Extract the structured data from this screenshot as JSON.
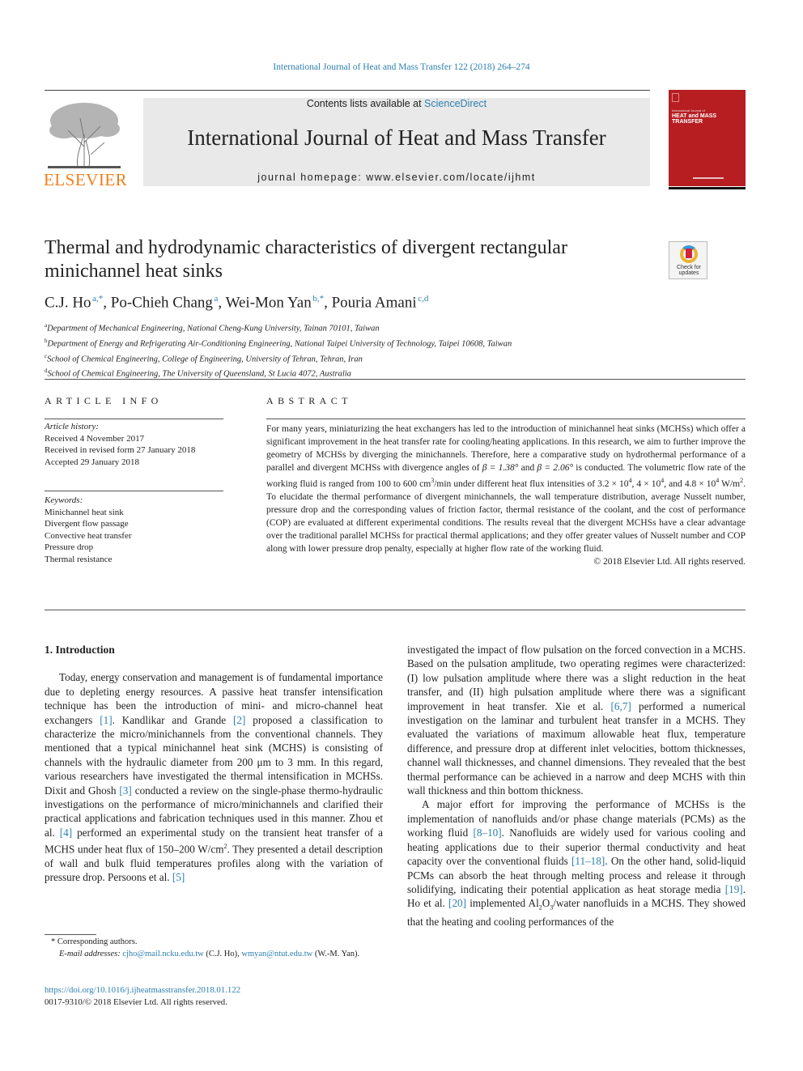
{
  "running_head": "International Journal of Heat and Mass Transfer 122 (2018) 264–274",
  "masthead": {
    "publisher_logo_text": "ELSEVIER",
    "contents_prefix": "Contents lists available at ",
    "contents_link": "ScienceDirect",
    "journal_name": "International Journal of Heat and Mass Transfer",
    "homepage": "journal homepage: www.elsevier.com/locate/ijhmt",
    "cover": {
      "line1": "International Journal of",
      "line2": "HEAT and MASS",
      "line3": "TRANSFER",
      "color": "#b61e22"
    }
  },
  "article": {
    "title": "Thermal and hydrodynamic characteristics of divergent rectangular minichannel heat sinks",
    "check_updates": [
      "Check for",
      "updates"
    ],
    "authors": [
      {
        "name": "C.J. Ho",
        "sup": "a,*"
      },
      {
        "name": "Po-Chieh Chang",
        "sup": "a"
      },
      {
        "name": "Wei-Mon Yan",
        "sup": "b,*"
      },
      {
        "name": "Pouria Amani",
        "sup": "c,d"
      }
    ],
    "affiliations": [
      {
        "key": "a",
        "text": "Department of Mechanical Engineering, National Cheng-Kung University, Tainan 70101, Taiwan"
      },
      {
        "key": "b",
        "text": "Department of Energy and Refrigerating Air-Conditioning Engineering, National Taipei University of Technology, Taipei 10608, Taiwan"
      },
      {
        "key": "c",
        "text": "School of Chemical Engineering, College of Engineering, University of Tehran, Tehran, Iran"
      },
      {
        "key": "d",
        "text": "School of Chemical Engineering, The University of Queensland, St Lucia 4072, Australia"
      }
    ]
  },
  "article_info": {
    "heading": "ARTICLE INFO",
    "history_label": "Article history:",
    "history": [
      "Received 4 November 2017",
      "Received in revised form 27 January 2018",
      "Accepted 29 January 2018"
    ],
    "keywords_label": "Keywords:",
    "keywords": [
      "Minichannel heat sink",
      "Divergent flow passage",
      "Convective heat transfer",
      "Pressure drop",
      "Thermal resistance"
    ]
  },
  "abstract": {
    "heading": "ABSTRACT",
    "p1": "For many years, miniaturizing the heat exchangers has led to the introduction of minichannel heat sinks (MCHSs) which offer a significant improvement in the heat transfer rate for cooling/heating applications. In this research, we aim to further improve the geometry of MCHSs by diverging the minichannels. Therefore, here a comparative study on hydrothermal performance of a parallel and divergent MCHSs with divergence angles of ",
    "beta1": "β = 1.38°",
    "and1": " and ",
    "beta2": "β = 2.06°",
    "p2": " is conducted. The volumetric flow rate of the working fluid is ranged from 100 to 600 cm",
    "sup3": "3",
    "p3": "/min under different heat flux intensities of 3.2 × 10",
    "sup4a": "4",
    "p4": ", 4 × 10",
    "sup4b": "4",
    "p5": ", and 4.8 × 10",
    "sup4c": "4",
    "p6": " W/m",
    "sup2": "2",
    "p7": ". To elucidate the thermal performance of divergent minichannels, the wall temperature distribution, average Nusselt number, pressure drop and the corresponding values of friction factor, thermal resistance of the coolant, and the cost of performance (COP) are evaluated at different experimental conditions. The results reveal that the divergent MCHSs have a clear advantage over the traditional parallel MCHSs for practical thermal applications; and they offer greater values of Nusselt number and COP along with lower pressure drop penalty, especially at higher flow rate of the working fluid.",
    "copyright": "© 2018 Elsevier Ltd. All rights reserved."
  },
  "body": {
    "section_heading": "1. Introduction",
    "left": {
      "t1": "Today, energy conservation and management is of fundamental importance due to depleting energy resources. A passive heat transfer intensification technique has been the introduction of mini- and micro-channel heat exchangers ",
      "c1": "[1]",
      "t2": ". Kandlikar and Grande ",
      "c2": "[2]",
      "t3": " proposed a classification to characterize the micro/minichannels from the conventional channels. They mentioned that a typical minichannel heat sink (MCHS) is consisting of channels with the hydraulic diameter from 200 μm to 3 mm. In this regard, various researchers have investigated the thermal intensification in MCHSs. Dixit and Ghosh ",
      "c3": "[3]",
      "t4": " conducted a review on the single-phase thermo-hydraulic investigations on the performance of micro/minichannels and clarified their practical applications and fabrication techniques used in this manner. Zhou et al. ",
      "c4": "[4]",
      "t5": " performed an experimental study on the transient heat transfer of a MCHS under heat flux of 150–200 W/cm",
      "sup": "2",
      "t6": ". They presented a detail description of wall and bulk fluid temperatures profiles along with the variation of pressure drop. Persoons et al. ",
      "c5": "[5]"
    },
    "right": {
      "t1": "investigated the impact of flow pulsation on the forced convection in a MCHS. Based on the pulsation amplitude, two operating regimes were characterized: (I) low pulsation amplitude where there was a slight reduction in the heat transfer, and (II) high pulsation amplitude where there was a significant improvement in heat transfer. Xie et al. ",
      "c1": "[6,7]",
      "t2": " performed a numerical investigation on the laminar and turbulent heat transfer in a MCHS. They evaluated the variations of maximum allowable heat flux, temperature difference, and pressure drop at different inlet velocities, bottom thicknesses, channel wall thicknesses, and channel dimensions. They revealed that the best thermal performance can be achieved in a narrow and deep MCHS with thin wall thickness and thin bottom thickness.",
      "p2_t1": "A major effort for improving the performance of MCHSs is the implementation of nanofluids and/or phase change materials (PCMs) as the working fluid ",
      "p2_c1": "[8–10]",
      "p2_t2": ". Nanofluids are widely used for various cooling and heating applications due to their superior thermal conductivity and heat capacity over the conventional fluids ",
      "p2_c2": "[11–18]",
      "p2_t3": ". On the other hand, solid-liquid PCMs can absorb the heat through melting process and release it through solidifying, indicating their potential application as heat storage media ",
      "p2_c3": "[19]",
      "p2_t4": ". Ho et al. ",
      "p2_c4": "[20]",
      "p2_t5": " implemented Al",
      "sub2": "2",
      "o": "O",
      "sub3": "3",
      "p2_t6": "/water nanofluids in a MCHS. They showed that the heating and cooling performances of the"
    }
  },
  "footnotes": {
    "corresponding": "* Corresponding authors.",
    "email_label": "E-mail addresses:",
    "email1": "cjho@mail.ncku.edu.tw",
    "email1_owner": " (C.J. Ho), ",
    "email2": "wmyan@ntut.edu.tw",
    "email2_owner": " (W.-M. Yan).",
    "doi": "https://doi.org/10.1016/j.ijheatmasstransfer.2018.01.122",
    "issn": "0017-9310/© 2018 Elsevier Ltd. All rights reserved."
  },
  "colors": {
    "link": "#2e7fb0",
    "elsevier_orange": "#f07e1b",
    "masthead_bg": "#e9e9e9"
  }
}
